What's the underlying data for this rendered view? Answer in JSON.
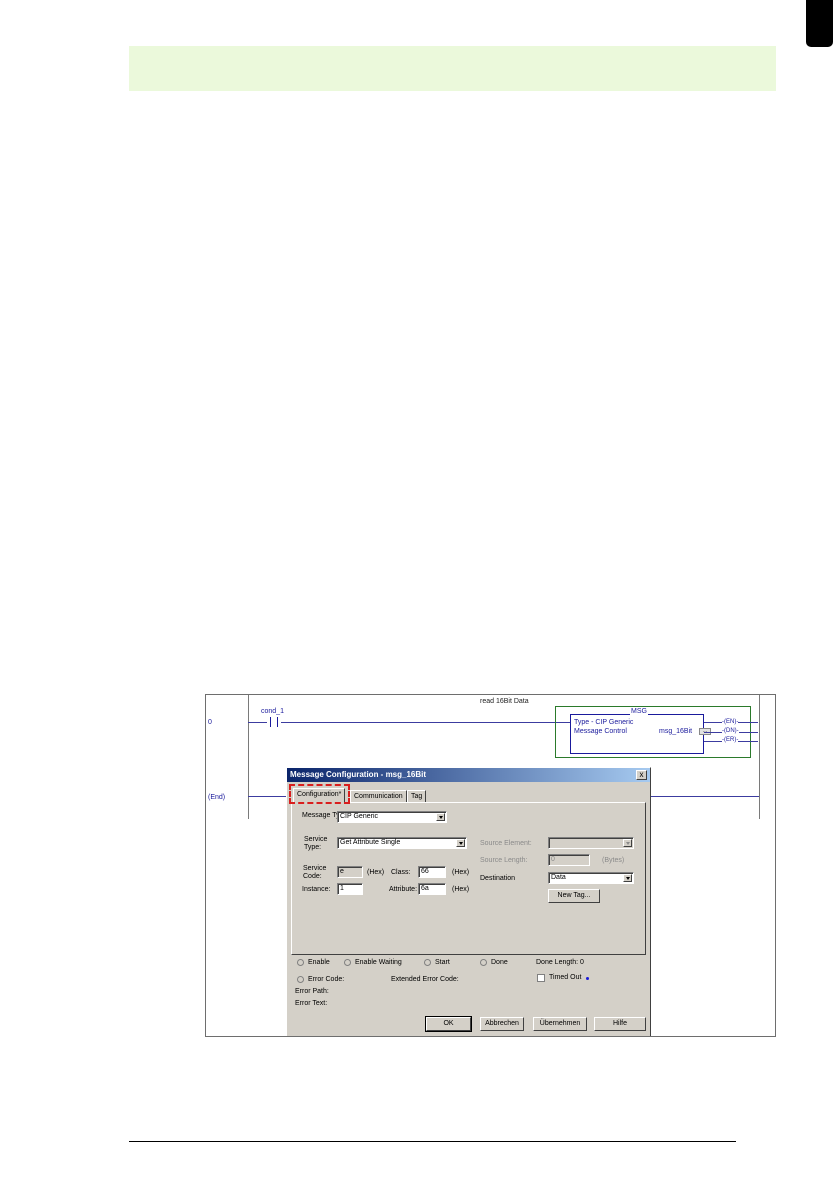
{
  "ladder": {
    "rung0_number": "0",
    "end_label": "(End)",
    "rung_title": "read 16Bit Data",
    "contact_tag": "cond_1",
    "msg_block": {
      "title": "MSG",
      "type_line": "Type - CIP Generic",
      "control_label": "Message Control",
      "control_tag": "msg_16Bit",
      "browse_label": "...",
      "coils": [
        "EN",
        "DN",
        "ER"
      ]
    }
  },
  "dialog": {
    "title": "Message Configuration - msg_16Bit",
    "close_label": "x",
    "tabs": [
      "Configuration*",
      "Communication",
      "Tag"
    ],
    "message_type_label": "Message Type:",
    "message_type_value": "CIP Generic",
    "service_type_label": "Service\nType:",
    "service_type_value": "Get Attribute Single",
    "service_code_label": "Service\nCode:",
    "service_code_value": "e",
    "hex_label": "(Hex)",
    "class_label": "Class:",
    "class_value": "66",
    "instance_label": "Instance:",
    "instance_value": "1",
    "attribute_label": "Attribute:",
    "attribute_value": "6a",
    "source_element_label": "Source Element:",
    "source_element_value": "",
    "source_length_label": "Source Length:",
    "source_length_value": "0",
    "bytes_label": "(Bytes)",
    "destination_label": "Destination",
    "destination_value": "Data",
    "new_tag_label": "New Tag...",
    "status": {
      "enable": "Enable",
      "enable_waiting": "Enable Waiting",
      "start": "Start",
      "done": "Done",
      "done_length": "Done Length: 0",
      "error_code": "Error Code:",
      "extended_error_code": "Extended Error Code:",
      "timed_out": "Timed Out",
      "timed_out_marker": "→",
      "error_path": "Error Path:",
      "error_text": "Error Text:"
    },
    "buttons": {
      "ok": "OK",
      "cancel": "Abbrechen",
      "apply": "Übernehmen",
      "help": "Hilfe"
    }
  },
  "colors": {
    "header_band": "#ebf9db",
    "highlight": "#d91e1e",
    "msg_border": "#2b7a2b",
    "ladder_text": "#1a1a9c"
  }
}
